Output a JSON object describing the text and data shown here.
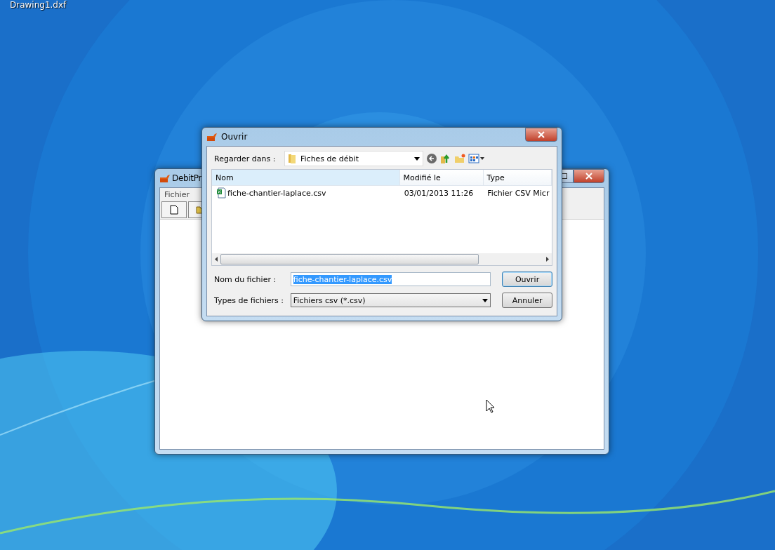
{
  "desktop": {
    "icon_label": "Drawing1.dxf"
  },
  "back_window": {
    "title": "DebitPr",
    "menu": [
      "Fichier"
    ],
    "toolbar_buttons": [
      {
        "kind": "new"
      },
      {
        "kind": "open"
      }
    ]
  },
  "dialog": {
    "title": "Ouvrir",
    "look_in": {
      "label": "Regarder dans :",
      "value": "Fiches de débit"
    },
    "columns": [
      "Nom",
      "Modifié le",
      "Type"
    ],
    "files": [
      {
        "name": "fiche-chantier-laplace.csv",
        "modified": "03/01/2013 11:26",
        "type": "Fichier CSV Micr",
        "selected": false
      }
    ],
    "filename": {
      "label": "Nom du fichier :",
      "value": "fiche-chantier-laplace.csv",
      "text_selected": true
    },
    "filetype": {
      "label": "Types de fichiers :",
      "value": "Fichiers csv (*.csv)"
    },
    "buttons": [
      "Ouvrir",
      "Annuler"
    ]
  }
}
